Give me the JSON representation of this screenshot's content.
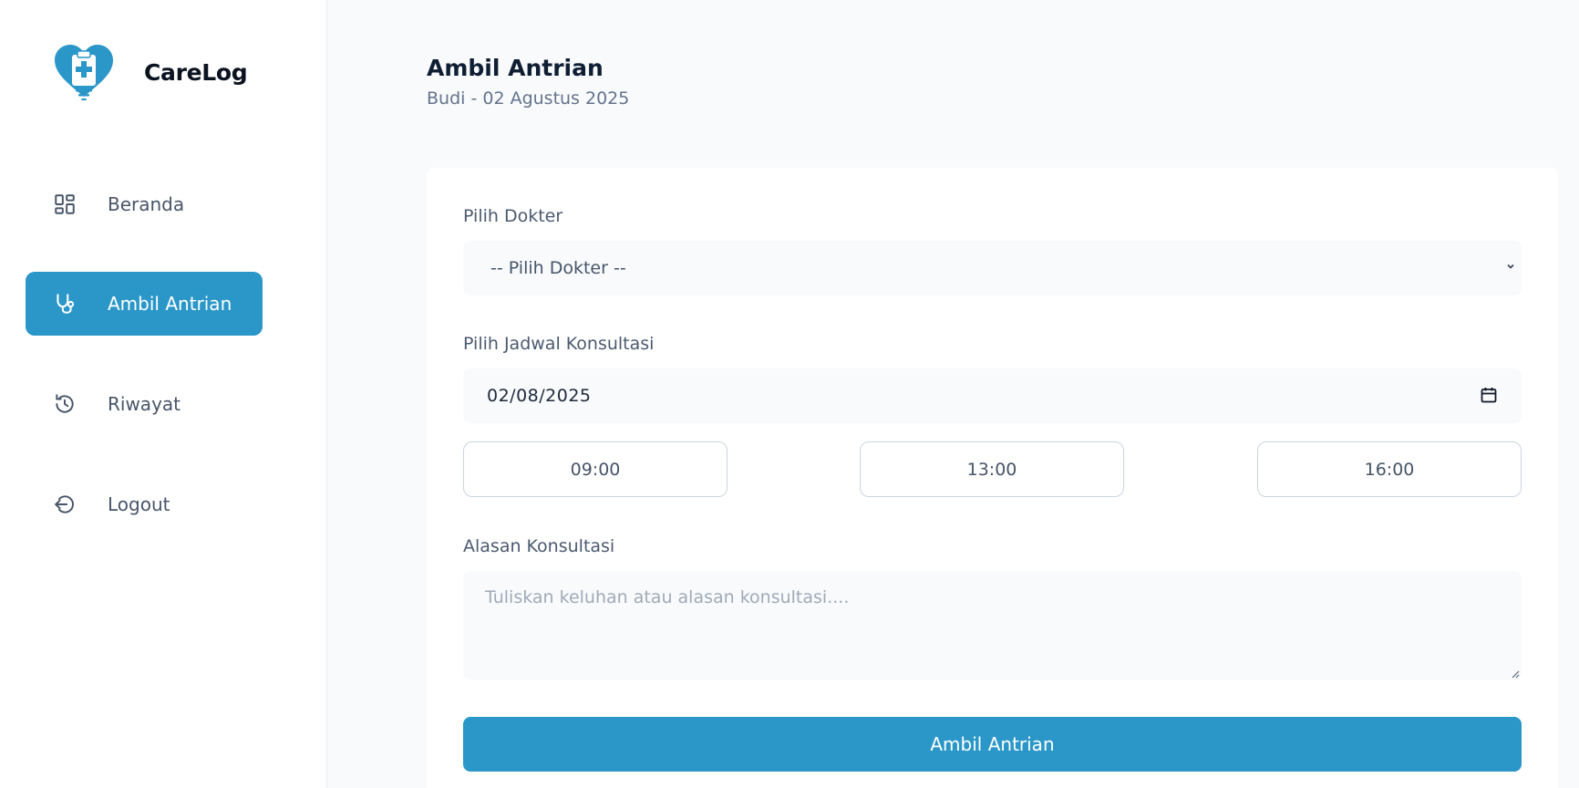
{
  "brand": {
    "name": "CareLog",
    "logo_icon": "heart-clipboard-medical-icon",
    "accent_color": "#2b97c9"
  },
  "sidebar": {
    "items": [
      {
        "label": "Beranda",
        "icon": "dashboard-icon",
        "active": false
      },
      {
        "label": "Ambil Antrian",
        "icon": "stethoscope-icon",
        "active": true
      },
      {
        "label": "Riwayat",
        "icon": "history-icon",
        "active": false
      },
      {
        "label": "Logout",
        "icon": "logout-icon",
        "active": false
      }
    ]
  },
  "header": {
    "title": "Ambil Antrian",
    "subtitle": "Budi - 02 Agustus 2025"
  },
  "form": {
    "doctor_label": "Pilih Dokter",
    "doctor_selected": "-- Pilih Dokter --",
    "schedule_label": "Pilih Jadwal Konsultasi",
    "date_value": "02/08/2025",
    "time_slots": [
      "09:00",
      "13:00",
      "16:00"
    ],
    "reason_label": "Alasan Konsultasi",
    "reason_placeholder": "Tuliskan keluhan atau alasan konsultasi....",
    "submit_label": "Ambil Antrian"
  }
}
